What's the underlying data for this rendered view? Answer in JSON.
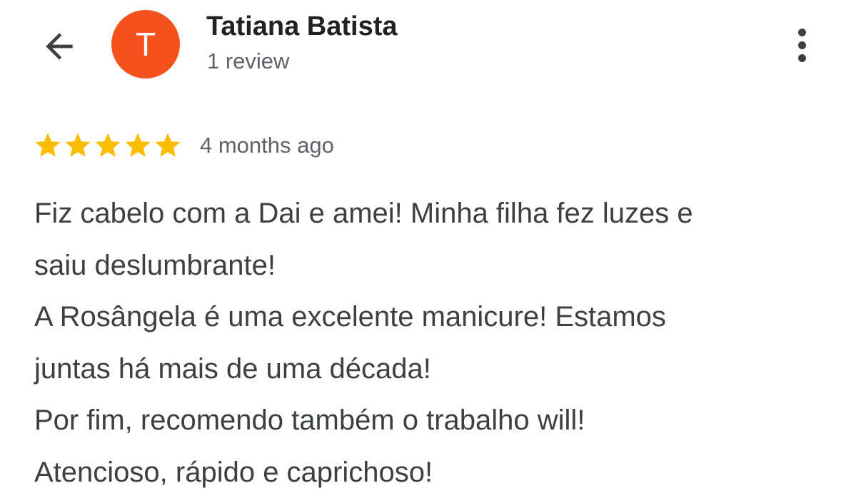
{
  "header": {
    "back_icon": "arrow-left-icon",
    "avatar_letter": "T",
    "avatar_color": "#f4511e",
    "author_name": "Tatiana Batista",
    "review_count": "1 review",
    "more_icon": "more-vertical-icon"
  },
  "review": {
    "rating": 5,
    "rating_max": 5,
    "star_color": "#fbbc04",
    "date": "4 months ago",
    "lines": [
      "Fiz cabelo com a Dai e amei! Minha filha fez luzes e",
      "saiu deslumbrante!",
      "A Rosângela é uma excelente manicure! Estamos",
      "juntas há mais de uma década!",
      "Por fim, recomendo também o trabalho will!",
      "Atencioso, rápido e caprichoso!"
    ]
  }
}
